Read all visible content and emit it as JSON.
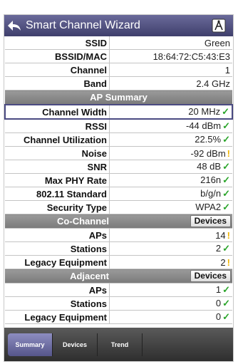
{
  "header": {
    "title": "Smart Channel Wizard"
  },
  "info_rows": [
    {
      "label": "SSID",
      "value": "Green"
    },
    {
      "label": "BSSID/MAC",
      "value": "18:64:72:C5:43:E3"
    },
    {
      "label": "Channel",
      "value": "1"
    },
    {
      "label": "Band",
      "value": "2.4 GHz"
    }
  ],
  "ap_summary": {
    "title": "AP Summary",
    "rows": [
      {
        "label": "Channel Width",
        "value": "20 MHz",
        "status": "ok"
      },
      {
        "label": "RSSI",
        "value": "-44 dBm",
        "status": "ok"
      },
      {
        "label": "Channel Utilization",
        "value": "22.5%",
        "status": "ok"
      },
      {
        "label": "Noise",
        "value": "-92 dBm",
        "status": "warn"
      },
      {
        "label": "SNR",
        "value": "48 dB",
        "status": "ok"
      },
      {
        "label": "Max PHY Rate",
        "value": "216n",
        "status": "ok"
      },
      {
        "label": "802.11 Standard",
        "value": "b/g/n",
        "status": "ok"
      },
      {
        "label": "Security Type",
        "value": "WPA2",
        "status": "ok"
      }
    ]
  },
  "co_channel": {
    "title": "Co-Channel",
    "button": "Devices",
    "rows": [
      {
        "label": "APs",
        "value": "14",
        "status": "warn"
      },
      {
        "label": "Stations",
        "value": "2",
        "status": "ok"
      },
      {
        "label": "Legacy Equipment",
        "value": "2",
        "status": "warn"
      }
    ]
  },
  "adjacent": {
    "title": "Adjacent",
    "button": "Devices",
    "rows": [
      {
        "label": "APs",
        "value": "1",
        "status": "ok"
      },
      {
        "label": "Stations",
        "value": "0",
        "status": "ok"
      },
      {
        "label": "Legacy Equipment",
        "value": "0",
        "status": "ok"
      }
    ]
  },
  "status_symbols": {
    "ok": "✓",
    "warn": "!"
  },
  "colors": {
    "ok": "#2aa52a",
    "warn": "#f0b400",
    "header": "#4d4d7e"
  },
  "tabs": [
    {
      "label": "Summary",
      "active": true
    },
    {
      "label": "Devices",
      "active": false
    },
    {
      "label": "Trend",
      "active": false
    }
  ]
}
